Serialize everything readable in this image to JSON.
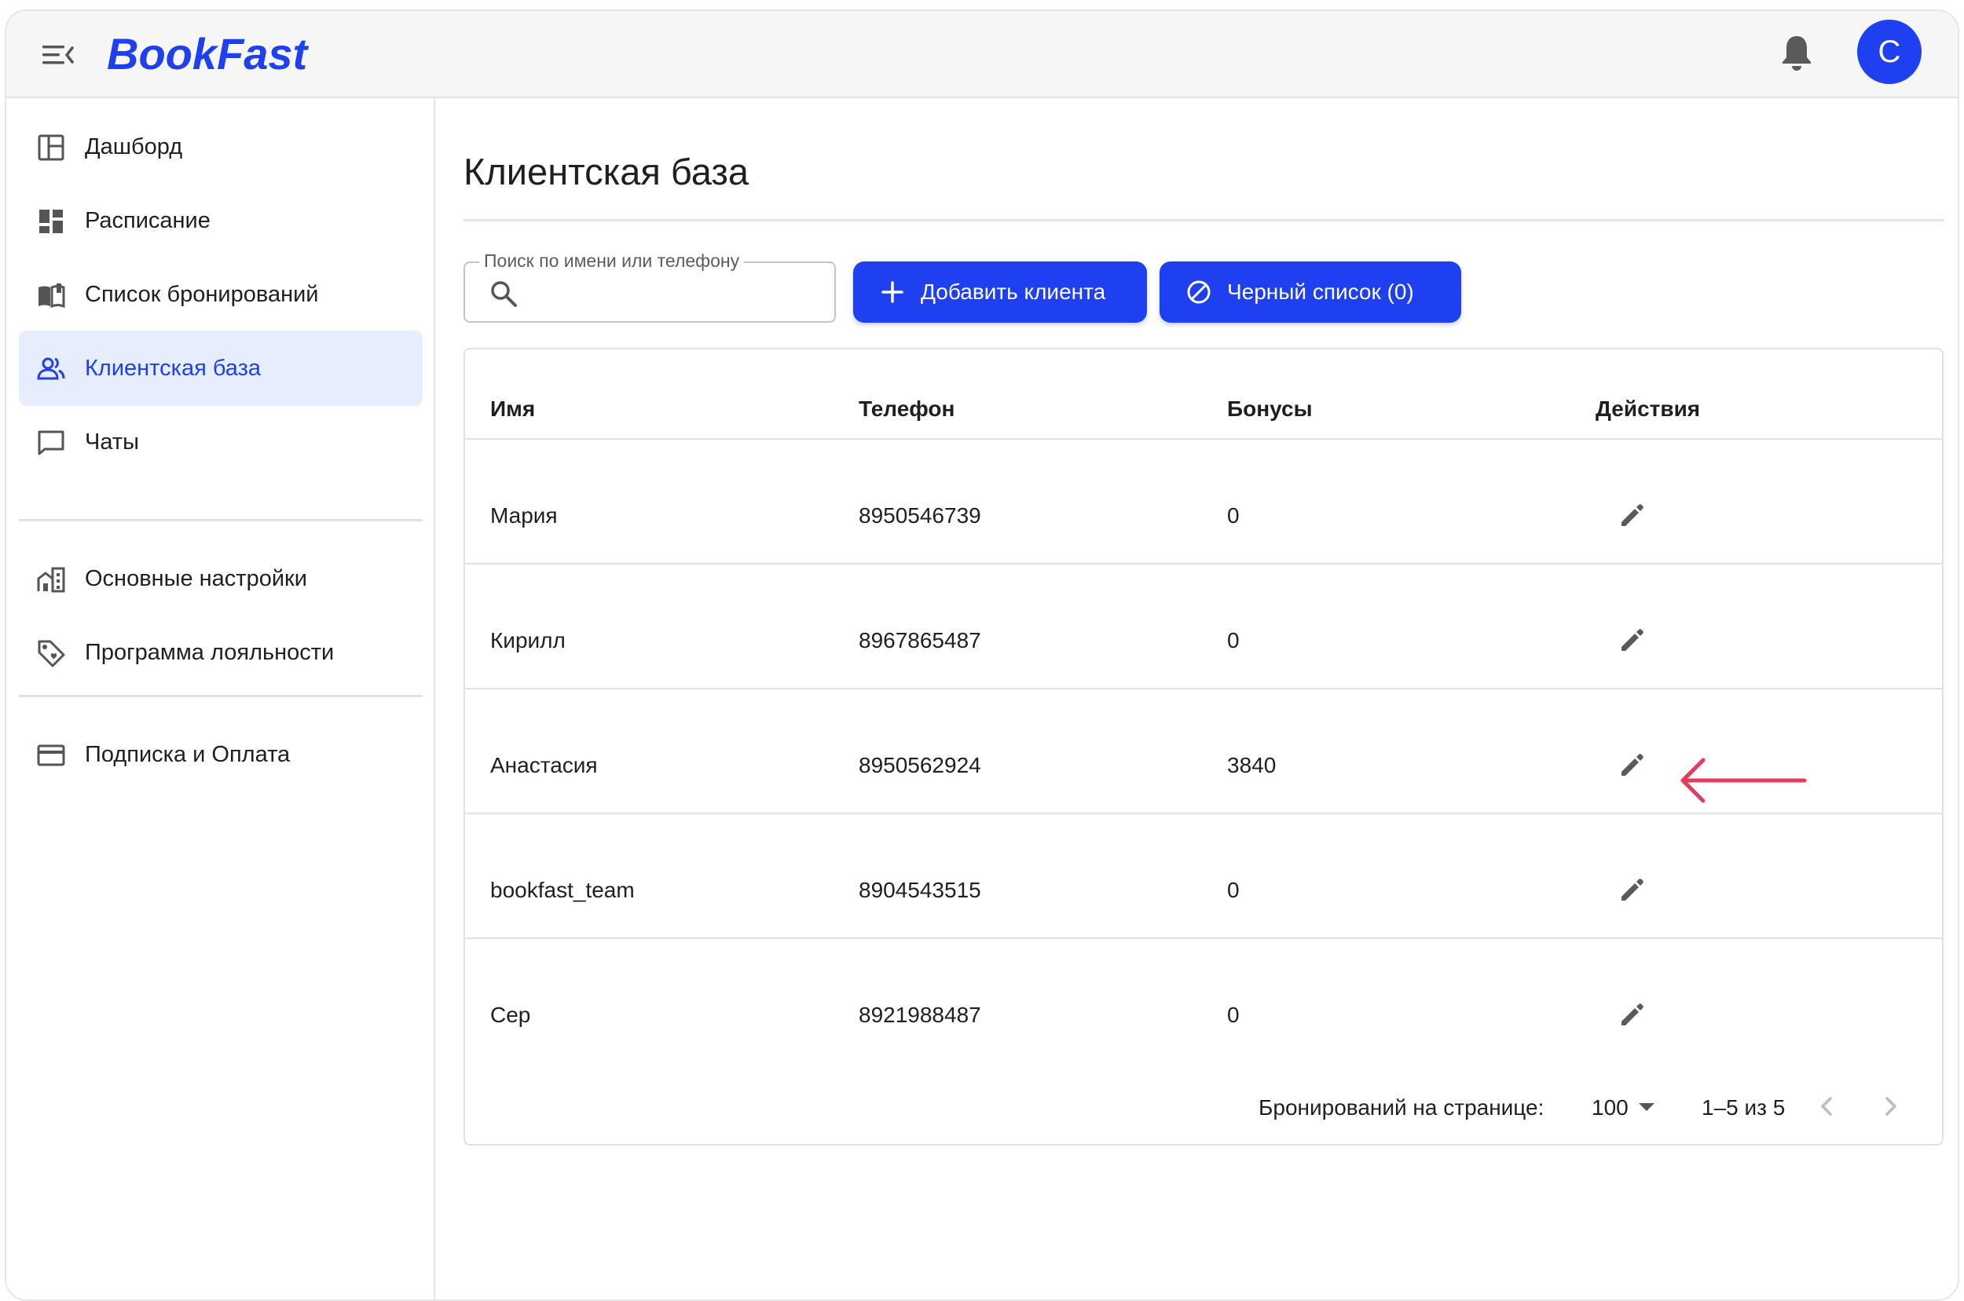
{
  "header": {
    "logo_text": "BookFast",
    "avatar_letter": "C",
    "brand_color": "#1e40f0"
  },
  "sidebar": {
    "items": [
      {
        "label": "Дашборд",
        "icon": "dashboard-layout-icon"
      },
      {
        "label": "Расписание",
        "icon": "schedule-grid-icon"
      },
      {
        "label": "Список бронирований",
        "icon": "book-icon"
      },
      {
        "label": "Клиентская база",
        "icon": "users-icon",
        "active": true
      },
      {
        "label": "Чаты",
        "icon": "chat-icon"
      },
      {
        "label": "Основные настройки",
        "icon": "building-icon"
      },
      {
        "label": "Программа лояльности",
        "icon": "tag-icon"
      },
      {
        "label": "Подписка и Оплата",
        "icon": "credit-card-icon"
      }
    ]
  },
  "main": {
    "title": "Клиентская база",
    "search": {
      "label": "Поиск по имени или телефону",
      "value": ""
    },
    "add_button": "Добавить клиента",
    "blacklist_button": "Черный список (0)",
    "table": {
      "headers": [
        "Имя",
        "Телефон",
        "Бонусы",
        "Действия"
      ],
      "rows": [
        {
          "name": "Мария",
          "phone": "8950546739",
          "bonus": "0"
        },
        {
          "name": "Кирилл",
          "phone": "8967865487",
          "bonus": "0"
        },
        {
          "name": "Анастасия",
          "phone": "8950562924",
          "bonus": "3840"
        },
        {
          "name": "bookfast_team",
          "phone": "8904543515",
          "bonus": "0"
        },
        {
          "name": "Сер",
          "phone": "8921988487",
          "bonus": "0"
        }
      ]
    },
    "pagination": {
      "rows_per_page_label": "Бронирований на странице:",
      "rows_per_page_value": "100",
      "range_text": "1–5 из 5"
    },
    "annotation_color": "#e83a5c"
  }
}
